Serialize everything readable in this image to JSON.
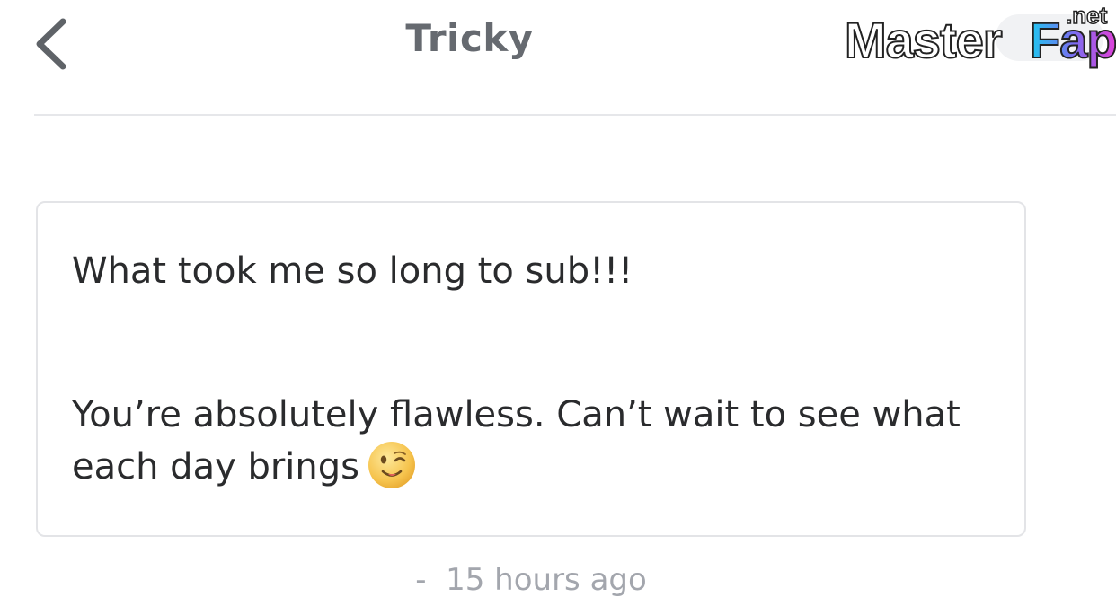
{
  "header": {
    "title": "Tricky",
    "back_icon": "chevron-left-icon"
  },
  "watermark": {
    "text": "MasterFap",
    "suffix": ".net"
  },
  "message": {
    "line1": "What took me so long to sub!!!",
    "line2": "You’re absolutely flawless. Can’t wait to see what",
    "line3": "each day brings",
    "emoji": "winking-face-icon"
  },
  "timestamp": {
    "prefix": "-",
    "text": "15 hours ago"
  },
  "colors": {
    "title": "#666a70",
    "body_text": "#2a2b2d",
    "timestamp": "#a3a6ad",
    "border": "#e3e4e7",
    "back_icon": "#5f6368",
    "watermark_fap_start": "#1ec8f0",
    "watermark_fap_end": "#e040d8"
  }
}
